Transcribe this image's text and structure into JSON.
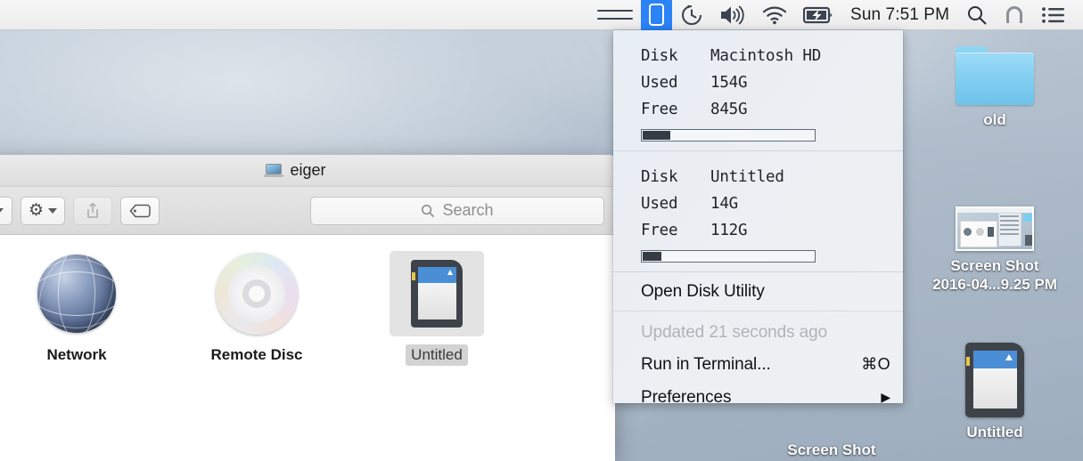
{
  "menubar": {
    "icons": [
      {
        "name": "bars-icon",
        "label": "bars"
      },
      {
        "name": "disk-indicator-icon",
        "label": "disk",
        "active": true
      },
      {
        "name": "time-machine-icon",
        "label": "time-machine"
      },
      {
        "name": "volume-icon",
        "label": "volume"
      },
      {
        "name": "wifi-icon",
        "label": "wifi"
      },
      {
        "name": "battery-charging-icon",
        "label": "battery"
      }
    ],
    "clock": "Sun 7:51 PM",
    "right_icons": [
      {
        "name": "spotlight-search-icon",
        "label": "search"
      },
      {
        "name": "siri-icon",
        "label": "siri"
      },
      {
        "name": "notification-center-icon",
        "label": "notifications"
      }
    ]
  },
  "disk_menu": {
    "sections": [
      {
        "disk_key": "Disk",
        "disk_value": "Macintosh HD",
        "used_key": "Used",
        "used_value": "154G",
        "free_key": "Free",
        "free_value": "845G",
        "fill_percent": 16
      },
      {
        "disk_key": "Disk",
        "disk_value": "Untitled",
        "used_key": "Used",
        "used_value": "14G",
        "free_key": "Free",
        "free_value": "112G",
        "fill_percent": 11
      }
    ],
    "open_disk_utility": "Open Disk Utility",
    "updated_status": "Updated 21 seconds ago",
    "run_in_terminal": "Run in Terminal...",
    "run_in_terminal_shortcut": "⌘O",
    "preferences": "Preferences",
    "preferences_arrow": "▶"
  },
  "finder": {
    "title": "eiger",
    "search_placeholder": "Search",
    "items": [
      {
        "label": "Network",
        "icon": "network-globe-icon",
        "selected": false
      },
      {
        "label": "Remote Disc",
        "icon": "optical-disc-icon",
        "selected": false
      },
      {
        "label": "Untitled",
        "icon": "sd-card-icon",
        "selected": true
      }
    ]
  },
  "desktop": {
    "icons": [
      {
        "label": "old",
        "icon": "folder-icon"
      },
      {
        "label": "Screen Shot\n2016-04...9.25 PM",
        "icon": "screenshot-thumbnail-icon"
      },
      {
        "label": "Untitled",
        "icon": "sd-card-icon"
      },
      {
        "label": "Screen Shot",
        "icon": "screenshot-label-partial"
      }
    ],
    "old_label": "old",
    "screenshot_line1": "Screen Shot",
    "screenshot_line2": "2016-04...9.25 PM",
    "sd_label": "Untitled",
    "screenshot_partial": "Screen Shot"
  },
  "colors": {
    "accent": "#2b83f5",
    "menu_bg": "#eaeef3",
    "bar_fill": "#343c45"
  }
}
